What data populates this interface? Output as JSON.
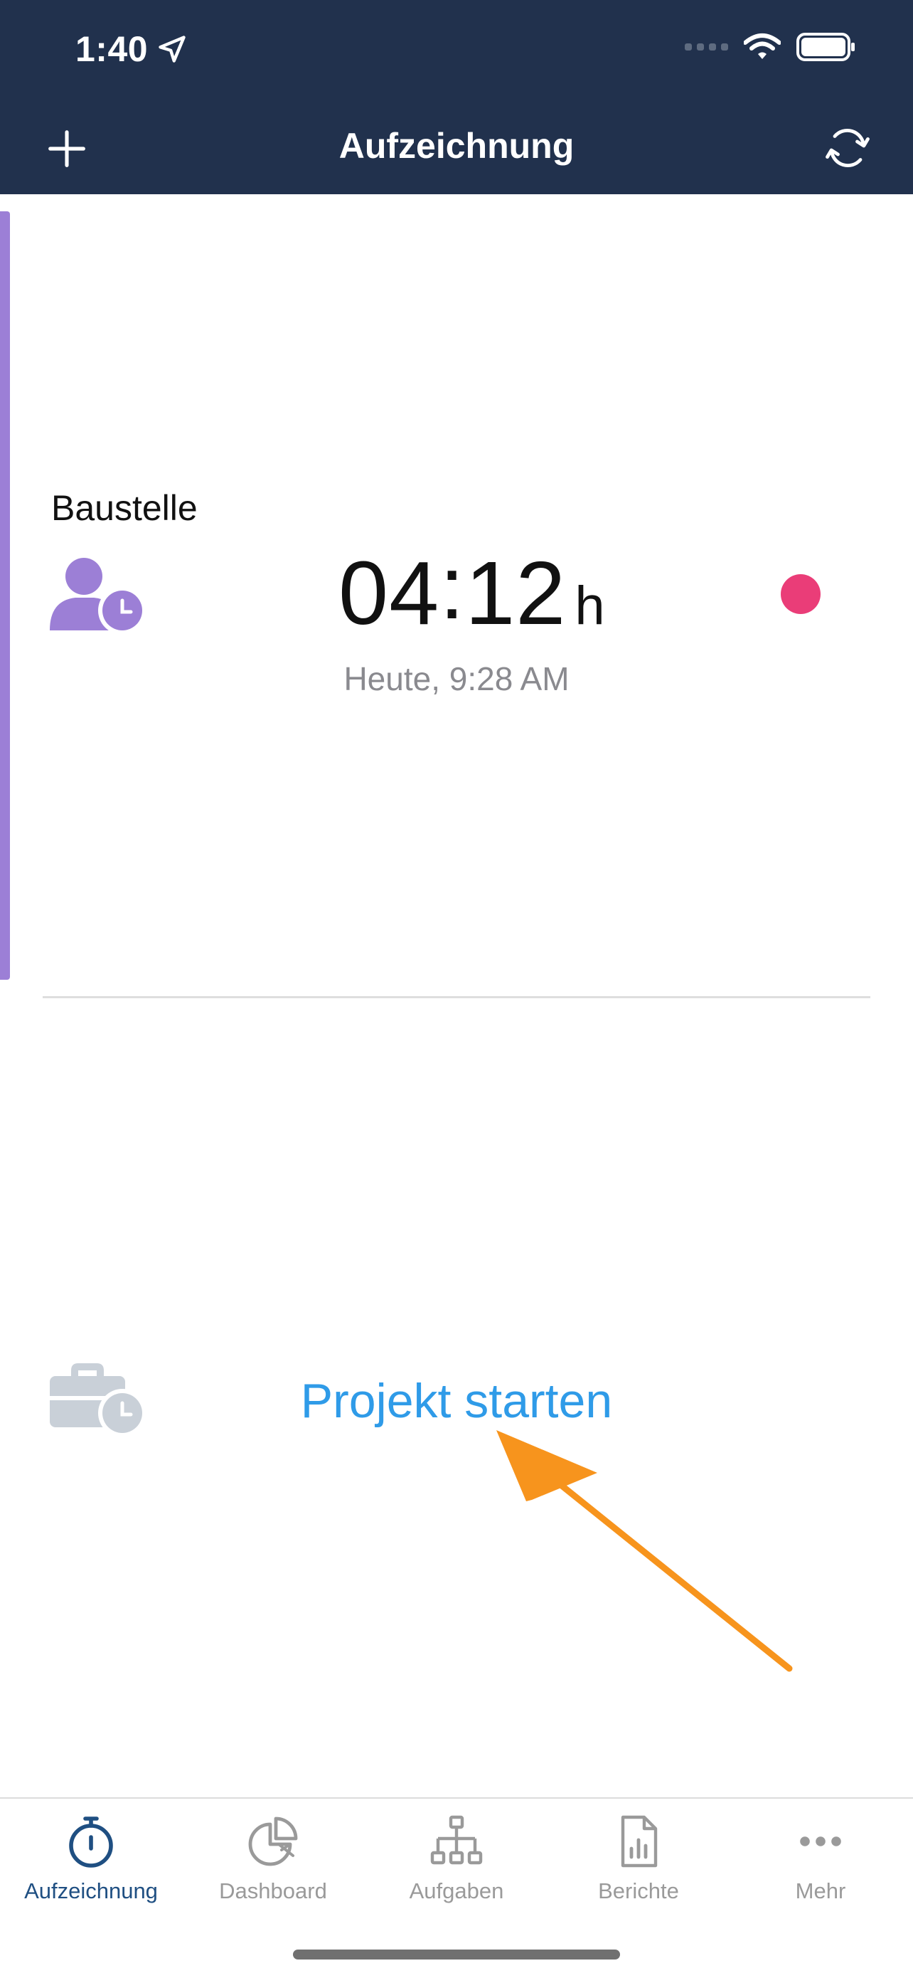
{
  "status_bar": {
    "time": "1:40",
    "location_icon": "location-arrow-icon"
  },
  "header": {
    "title": "Aufzeichnung",
    "add_icon": "plus-icon",
    "sync_icon": "sync-icon"
  },
  "entry": {
    "label": "Baustelle",
    "duration": "04",
    "duration_minutes": "12",
    "unit": "h",
    "started": "Heute, 9:28 AM",
    "icon": "person-clock-icon",
    "recording_color": "#ea3d78",
    "accent_color": "#9c7fd6"
  },
  "project": {
    "label": "Projekt starten",
    "icon": "briefcase-clock-icon"
  },
  "tabs": [
    {
      "label": "Aufzeichnung",
      "icon": "stopwatch-icon",
      "active": true
    },
    {
      "label": "Dashboard",
      "icon": "pie-chart-icon",
      "active": false
    },
    {
      "label": "Aufgaben",
      "icon": "hierarchy-icon",
      "active": false
    },
    {
      "label": "Berichte",
      "icon": "report-icon",
      "active": false
    },
    {
      "label": "Mehr",
      "icon": "more-icon",
      "active": false
    }
  ],
  "colors": {
    "header_bg": "#21314d",
    "link": "#2f9be8",
    "active_tab": "#1f4f82",
    "annotation_arrow": "#f7941d"
  }
}
